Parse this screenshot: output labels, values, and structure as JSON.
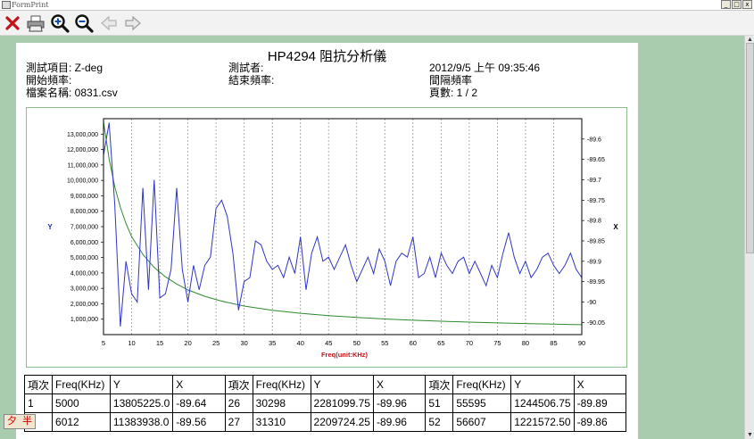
{
  "window": {
    "title": "FormPrint",
    "controls": [
      "_",
      "□",
      "x"
    ]
  },
  "toolbar": {
    "buttons": [
      "close-icon",
      "printer-icon",
      "zoom-in-icon",
      "zoom-out-icon",
      "back-arrow-icon",
      "forward-arrow-icon"
    ]
  },
  "report": {
    "title": "HP4294 阻抗分析儀",
    "test_item": "測試項目: Z-deg",
    "tester": "測試者:",
    "datetime": "2012/9/5 上午 09:35:46",
    "start_freq": "開始頻率:",
    "end_freq": "結束頻率:",
    "interval_freq": "間隔頻率",
    "file_name": "檔案名稱: 0831.csv",
    "page": "頁數: 1 / 2"
  },
  "chart_data": {
    "type": "line",
    "xlabel": "Freq(unit:KHz)",
    "ylabel": "Y",
    "y2label": "X",
    "xlim": [
      5,
      90
    ],
    "ylim": [
      0,
      14000000
    ],
    "y2lim": [
      -90.08,
      -89.55
    ],
    "x_ticks": [
      5,
      10,
      15,
      20,
      25,
      30,
      35,
      40,
      45,
      50,
      55,
      60,
      65,
      70,
      75,
      80,
      85,
      90
    ],
    "y_ticks": [
      "1,000,000",
      "2,000,000",
      "3,000,000",
      "4,000,000",
      "5,000,000",
      "6,000,000",
      "7,000,000",
      "8,000,000",
      "9,000,000",
      "10,000,000",
      "11,000,000",
      "12,000,000",
      "13,000,000"
    ],
    "y_tick_values": [
      1000000,
      2000000,
      3000000,
      4000000,
      5000000,
      6000000,
      7000000,
      8000000,
      9000000,
      10000000,
      11000000,
      12000000,
      13000000
    ],
    "y2_ticks": [
      "-89.6",
      "-89.65",
      "-89.7",
      "-89.75",
      "-89.8",
      "-89.85",
      "-89.9",
      "-89.95",
      "-90",
      "-90.05"
    ],
    "y2_tick_values": [
      -89.6,
      -89.65,
      -89.7,
      -89.75,
      -89.8,
      -89.85,
      -89.9,
      -89.95,
      -90.0,
      -90.05
    ],
    "grid": "vertical dashed",
    "series": [
      {
        "color": "#2d8a2d",
        "axis": "Y",
        "x": [
          5,
          6,
          7,
          8,
          9,
          10,
          12,
          14,
          16,
          18,
          20,
          23,
          26,
          30,
          35,
          40,
          45,
          50,
          55,
          60,
          65,
          70,
          75,
          80,
          85,
          90
        ],
        "values": [
          13805225,
          11383938,
          9600000,
          8250000,
          7200000,
          6350000,
          5200000,
          4350000,
          3750000,
          3280000,
          2900000,
          2480000,
          2170000,
          1850000,
          1580000,
          1380000,
          1230000,
          1110000,
          1010000,
          930000,
          865000,
          810000,
          760000,
          715000,
          675000,
          640000
        ]
      },
      {
        "color": "#2f35c4",
        "axis": "X",
        "x": [
          5,
          6,
          7,
          8,
          9,
          10,
          11,
          12,
          13,
          14,
          15,
          16,
          17,
          18,
          19,
          20,
          21,
          22,
          23,
          24,
          25,
          26,
          27,
          28,
          29,
          30,
          31,
          32,
          33,
          34,
          35,
          36,
          37,
          38,
          39,
          40,
          41,
          42,
          43,
          44,
          45,
          46,
          47,
          48,
          49,
          50,
          51,
          52,
          53,
          54,
          55,
          56,
          57,
          58,
          59,
          60,
          61,
          62,
          63,
          64,
          65,
          66,
          67,
          68,
          69,
          70,
          71,
          72,
          73,
          74,
          75,
          76,
          77,
          78,
          79,
          80,
          81,
          82,
          83,
          84,
          85,
          86,
          87,
          88,
          89,
          90
        ],
        "values": [
          -89.64,
          -89.56,
          -89.76,
          -90.06,
          -89.9,
          -89.98,
          -90.0,
          -89.72,
          -89.97,
          -89.7,
          -89.99,
          -89.98,
          -89.92,
          -89.72,
          -89.92,
          -90.0,
          -89.91,
          -89.97,
          -89.91,
          -89.89,
          -89.77,
          -89.75,
          -89.79,
          -89.88,
          -90.02,
          -89.95,
          -89.94,
          -89.85,
          -89.86,
          -89.9,
          -89.92,
          -89.91,
          -89.94,
          -89.89,
          -89.93,
          -89.84,
          -89.97,
          -89.88,
          -89.84,
          -89.9,
          -89.89,
          -89.92,
          -89.89,
          -89.86,
          -89.91,
          -89.95,
          -89.92,
          -89.89,
          -89.93,
          -89.87,
          -89.9,
          -89.96,
          -89.9,
          -89.88,
          -89.89,
          -89.84,
          -89.94,
          -89.93,
          -89.89,
          -89.94,
          -89.88,
          -89.91,
          -89.93,
          -89.9,
          -89.89,
          -89.93,
          -89.9,
          -89.93,
          -89.96,
          -89.91,
          -89.94,
          -89.88,
          -89.83,
          -89.89,
          -89.93,
          -89.9,
          -89.94,
          -89.92,
          -89.89,
          -89.88,
          -89.91,
          -89.93,
          -89.91,
          -89.88,
          -89.92,
          -89.94
        ]
      }
    ]
  },
  "table": {
    "headers": [
      "項次",
      "Freq(KHz)",
      "Y",
      "X",
      "項次",
      "Freq(KHz)",
      "Y",
      "X",
      "項次",
      "Freq(KHz)",
      "Y",
      "X"
    ],
    "rows": [
      [
        "1",
        "5000",
        "13805225.0",
        "-89.64",
        "26",
        "30298",
        "2281099.75",
        "-89.96",
        "51",
        "55595",
        "1244506.75",
        "-89.89"
      ],
      [
        "",
        "6012",
        "11383938.0",
        "-89.56",
        "27",
        "31310",
        "2209724.25",
        "-89.96",
        "52",
        "56607",
        "1221572.50",
        "-89.86"
      ]
    ]
  },
  "ime": {
    "left": "夕",
    "right": "半"
  }
}
